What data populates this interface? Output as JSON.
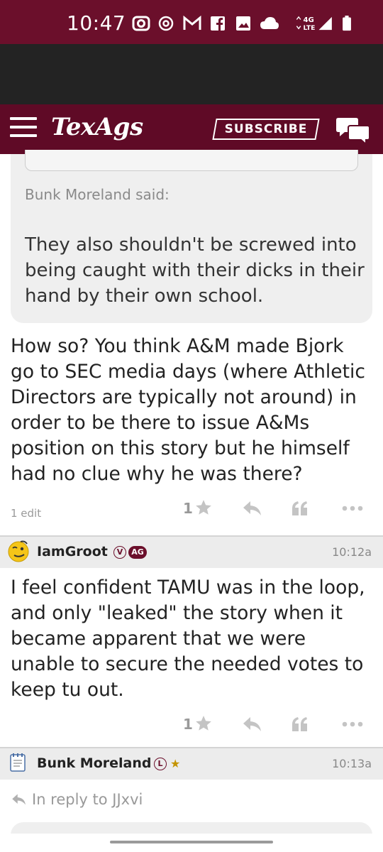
{
  "status_bar": {
    "time": "10:47",
    "network": "4G LTE"
  },
  "app_header": {
    "logo": "TexAgs",
    "subscribe_label": "SUBSCRIBE"
  },
  "quoted": {
    "author": "Bunk Moreland said:",
    "text": "They also shouldn't be screwed into being caught with their dicks in their hand by their own school."
  },
  "posts": [
    {
      "text": "How so? You think A&M made Bjork go to SEC media days (where Athletic Directors are typically not around) in order to be there to issue A&Ms position on this story but he himself had no clue why he was there?",
      "edit_note": "1 edit",
      "star_count": "1"
    },
    {
      "username": "IamGroot",
      "badge_v": "V",
      "badge_ag": "AG",
      "timestamp": "10:12a",
      "text": "I feel confident TAMU was in the loop, and only \"leaked\" the story when it became apparent that we were unable to secure the needed votes to keep tu out.",
      "star_count": "1"
    },
    {
      "username": "Bunk Moreland",
      "badge_l": "L",
      "timestamp": "10:13a",
      "reply_to": "In reply to JJxvi"
    }
  ],
  "colors": {
    "brand_maroon": "#5f0a26",
    "status_bar": "#6b0f2b",
    "quote_bg": "#efefef"
  },
  "icons": [
    "hamburger-icon",
    "chat-bubbles-icon",
    "star-icon",
    "reply-icon",
    "quote-icon",
    "more-icon"
  ]
}
